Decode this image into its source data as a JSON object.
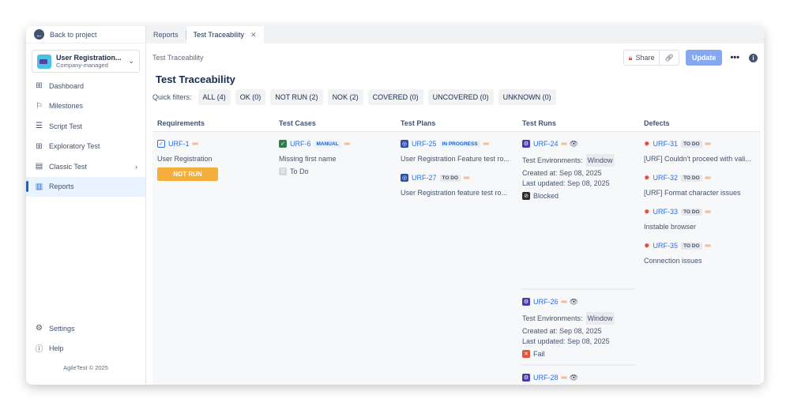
{
  "sidebar": {
    "back": "Back to project",
    "project": {
      "name": "User Registration...",
      "type": "Company-managed"
    },
    "items": [
      {
        "label": "Dashboard",
        "icon": "grid-icon"
      },
      {
        "label": "Milestones",
        "icon": "flag-icon"
      },
      {
        "label": "Script Test",
        "icon": "list-play-icon"
      },
      {
        "label": "Exploratory Test",
        "icon": "grid-icon"
      },
      {
        "label": "Classic Test",
        "icon": "table-icon"
      },
      {
        "label": "Reports",
        "icon": "chart-icon"
      }
    ],
    "settings": "Settings",
    "help": "Help",
    "footer": "AgileTest © 2025"
  },
  "tabs": [
    "Reports",
    "Test Traceability"
  ],
  "breadcrumb": "Test Traceability",
  "actions": {
    "share": "Share",
    "update": "Update"
  },
  "title": "Test Traceability",
  "quick_filters": {
    "label": "Quick filters:",
    "chips": [
      "ALL (4)",
      "OK (0)",
      "NOT RUN (2)",
      "NOK (2)",
      "COVERED (0)",
      "UNCOVERED (0)",
      "UNKNOWN (0)"
    ]
  },
  "columns": [
    "Requirements",
    "Test Cases",
    "Test Plans",
    "Test Runs",
    "Defects"
  ],
  "requirement": {
    "key": "URF-1",
    "summary": "User Registration",
    "status": "NOT RUN"
  },
  "test_case": {
    "key": "URF-6",
    "type": "MANUAL",
    "summary": "Missing first name",
    "status": "To Do"
  },
  "test_plans": [
    {
      "key": "URF-25",
      "status": "IN PROGRESS",
      "summary": "User Registration Feature test ro..."
    },
    {
      "key": "URF-27",
      "status": "TO DO",
      "summary": "User Registration feature test ro..."
    }
  ],
  "test_runs": [
    {
      "key": "URF-24",
      "env_label": "Test Environments:",
      "env": "Window",
      "created": "Created at: Sep 08, 2025",
      "updated": "Last updated: Sep 08, 2025",
      "status": "Blocked"
    },
    {
      "key": "URF-26",
      "env_label": "Test Environments:",
      "env": "Window",
      "created": "Created at: Sep 08, 2025",
      "updated": "Last updated: Sep 08, 2025",
      "status": "Fail"
    },
    {
      "key": "URF-28"
    }
  ],
  "defects": [
    {
      "key": "URF-31",
      "status": "TO DO",
      "summary": "[URF] Couldn't proceed with vali..."
    },
    {
      "key": "URF-32",
      "status": "TO DO",
      "summary": "[URF] Format character issues"
    },
    {
      "key": "URF-33",
      "status": "TO DO",
      "summary": "Instable browser"
    },
    {
      "key": "URF-35",
      "status": "TO DO",
      "summary": "Connection issues"
    }
  ],
  "colors": {
    "accent": "#0c66e4",
    "not_run": "#f5ad3b",
    "update": "#85a8f0",
    "defect": "#e5493a"
  }
}
